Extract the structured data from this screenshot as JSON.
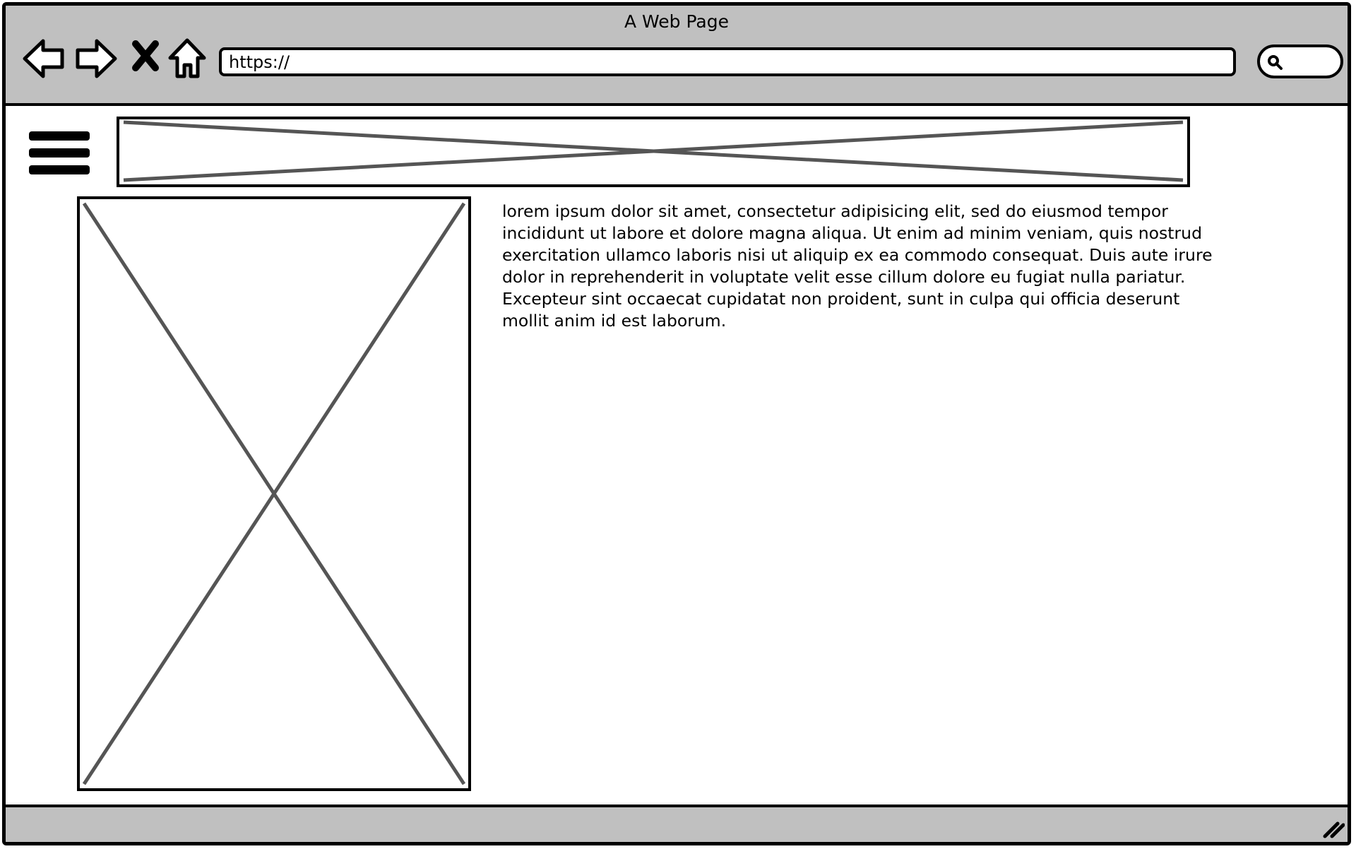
{
  "window": {
    "title": "A Web Page"
  },
  "toolbar": {
    "back_icon": "back-arrow-icon",
    "forward_icon": "forward-arrow-icon",
    "stop_icon": "close-icon",
    "home_icon": "home-icon"
  },
  "address_bar": {
    "value": "https://"
  },
  "search": {
    "icon": "search-icon"
  },
  "menu": {
    "icon": "hamburger-menu-icon"
  },
  "content": {
    "paragraph": "lorem ipsum dolor sit amet, consectetur adipisicing elit, sed do eiusmod tempor incididunt ut labore et dolore magna aliqua. Ut enim ad minim veniam, quis nostrud exercitation ullamco laboris nisi ut aliquip ex ea commodo consequat. Duis aute irure dolor in reprehenderit in voluptate velit esse cillum dolore eu fugiat nulla pariatur. Excepteur sint occaecat cupidatat non proident, sunt in culpa qui officia deserunt mollit anim id est laborum."
  },
  "colors": {
    "chrome_gray": "#c0c0c0",
    "outline": "#000000",
    "placeholder_cross": "#555555",
    "page_background": "#ffffff"
  }
}
